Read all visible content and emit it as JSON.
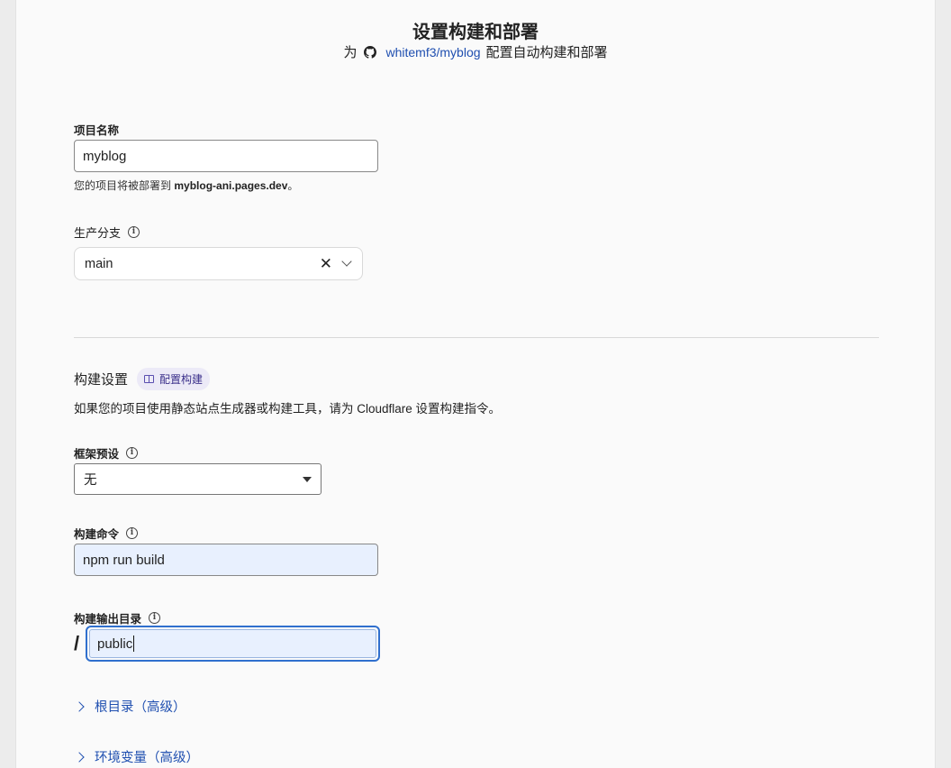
{
  "header": {
    "title": "设置构建和部署",
    "subtitle_prefix": "为",
    "repo": "whitemf3/myblog",
    "subtitle_suffix": "配置自动构建和部署"
  },
  "project_name": {
    "label": "项目名称",
    "value": "myblog",
    "help_prefix": "您的项目将被部署到",
    "help_domain": "myblog-ani.pages.dev",
    "help_suffix": "。"
  },
  "production_branch": {
    "label": "生产分支",
    "value": "main"
  },
  "build_settings": {
    "title": "构建设置",
    "badge": "配置构建",
    "description": "如果您的项目使用静态站点生成器或构建工具，请为 Cloudflare 设置构建指令。"
  },
  "framework_preset": {
    "label": "框架预设",
    "value": "无"
  },
  "build_command": {
    "label": "构建命令",
    "value": "npm run build"
  },
  "output_dir": {
    "label": "构建输出目录",
    "prefix": "/",
    "value": "public"
  },
  "expanders": {
    "root_dir": "根目录（高级）",
    "env_vars": "环境变量（高级）"
  },
  "colors": {
    "accent": "#1f4fb0",
    "focus": "#2f6fce",
    "filled_input": "#e8f0fe",
    "badge_bg": "#eceaf7"
  }
}
